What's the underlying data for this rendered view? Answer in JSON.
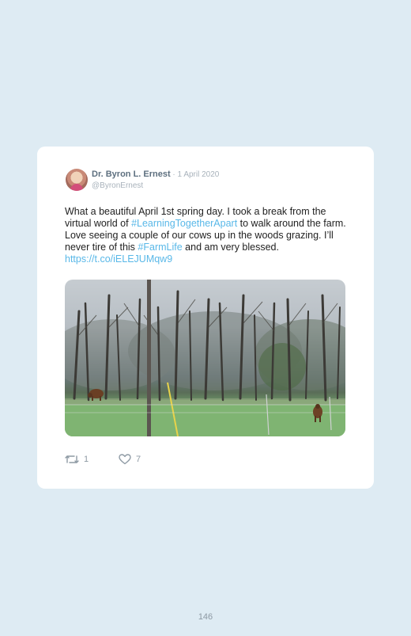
{
  "tweet": {
    "author_name": "Dr. Byron L. Ernest",
    "separator": " · ",
    "date": "1 April 2020",
    "handle": "@ByronErnest",
    "text_parts": [
      "What a beautiful April 1st spring day. I took a break from the virtual world of ",
      "#LearningTogetherApart",
      " to walk around the farm. Love seeing a couple of our cows up in the woods grazing. I’ll never tire of this ",
      "#FarmLife",
      " and am very blessed. ",
      "https://t.co/iELEJUMqw9"
    ],
    "retweet_count": "1",
    "like_count": "7",
    "icons": {
      "retweet": "retweet-icon",
      "like": "heart-icon"
    },
    "colors": {
      "link": "#59b8e8",
      "background": "#deebf3",
      "card": "#ffffff"
    }
  },
  "page": {
    "number": "146"
  }
}
